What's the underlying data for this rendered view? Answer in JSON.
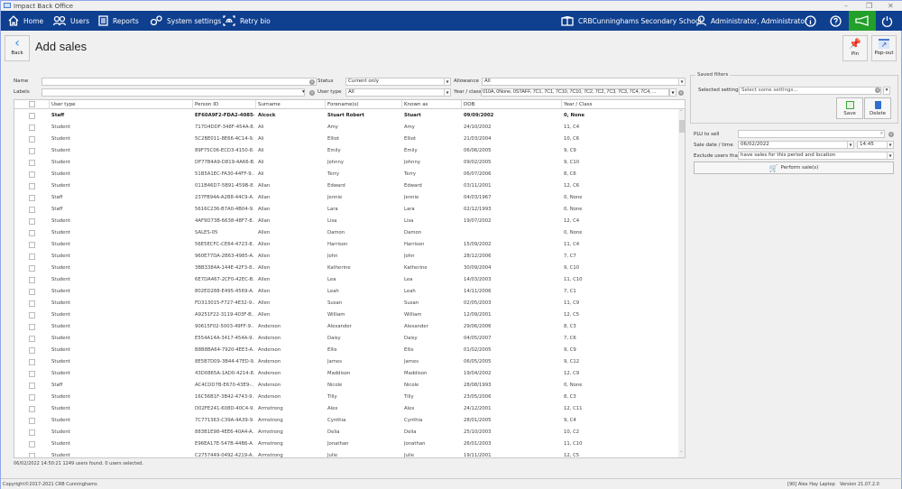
{
  "window": {
    "title": "Impact Back Office"
  },
  "nav": {
    "items": [
      {
        "label": "Home",
        "icon": "home-icon"
      },
      {
        "label": "Users",
        "icon": "users-icon"
      },
      {
        "label": "Reports",
        "icon": "reports-icon"
      },
      {
        "label": "System settings",
        "icon": "gears-icon"
      },
      {
        "label": "Retry bio",
        "icon": "fingerprint-icon"
      }
    ],
    "school": "CRBCunninghams Secondary School",
    "user": "Administrator, Administrator",
    "accent": "#0f3f8f",
    "announce_color": "#22a02a"
  },
  "page": {
    "back_label": "Back",
    "title": "Add sales",
    "pin_label": "Pin",
    "popout_label": "Pop-out"
  },
  "filters": {
    "name_label": "Name",
    "name_value": "",
    "labels_label": "Labels",
    "labels_value": "",
    "status_label": "Status",
    "status_value": "Current only",
    "usertype_label": "User type",
    "usertype_value": "All",
    "allowance_label": "Allowance",
    "allowance_value": "All",
    "yearclass_label": "Year / class",
    "yearclass_value": "010A, 0None, 0STAFF, 7C1, 7C1, 7C10, 7C10, 7C2, 7C2, 7C3, 7C3, 7C4, 7C4, ..."
  },
  "table": {
    "columns": [
      "User type",
      "Person ID",
      "Surname",
      "Forename(s)",
      "Known as",
      "DOB",
      "Year / Class"
    ],
    "rows": [
      [
        "Staff",
        "EF60A9F2-FDA2-4085-8...",
        "Alcock",
        "Stuart Robert",
        "Stuart",
        "09/09/2002",
        "0, None"
      ],
      [
        "Student",
        "717D4DDF-348F-454A-8...",
        "Ali",
        "Amy",
        "Amy",
        "24/10/2002",
        "11, C4"
      ],
      [
        "Student",
        "5C2BE011-8E66-4C14-9...",
        "Ali",
        "Elliot",
        "Elliot",
        "21/03/2004",
        "10, C6"
      ],
      [
        "Student",
        "89F75C06-ECD3-4150-8...",
        "Ali",
        "Emily",
        "Emily",
        "06/06/2005",
        "9, C9"
      ],
      [
        "Student",
        "DF77B4A9-D819-4A66-B...",
        "Ali",
        "Johnny",
        "Johnny",
        "09/02/2005",
        "9, C10"
      ],
      [
        "Student",
        "51B5A1EC-FA30-44FF-9...",
        "Ali",
        "Terry",
        "Terry",
        "06/07/2006",
        "8, C6"
      ],
      [
        "Student",
        "011B46D7-5B91-459B-8...",
        "Allan",
        "Edward",
        "Edward",
        "03/11/2001",
        "12, C6"
      ],
      [
        "Staff",
        "237FB94A-A2B8-44C9-A...",
        "Allan",
        "Jennie",
        "Jennie",
        "04/03/1967",
        "0, None"
      ],
      [
        "Staff",
        "5616C236-B7A0-4B04-9...",
        "Allan",
        "Lara",
        "Lara",
        "02/12/1993",
        "0, None"
      ],
      [
        "Student",
        "4AF9D73B-6638-48F7-8...",
        "Allan",
        "Lisa",
        "Lisa",
        "19/07/2002",
        "12, C4"
      ],
      [
        "Student",
        "SALES-05",
        "Allen",
        "Damon",
        "Damon",
        "",
        "0, None"
      ],
      [
        "Student",
        "56E5ECFC-CE64-4723-8...",
        "Allen",
        "Harrison",
        "Harrison",
        "15/09/2002",
        "11, C4"
      ],
      [
        "Student",
        "960E77DA-2B63-4985-A...",
        "Allen",
        "John",
        "John",
        "28/12/2006",
        "7, C7"
      ],
      [
        "Student",
        "3BB3384A-144E-42F3-8...",
        "Allen",
        "Katherine",
        "Katherine",
        "30/09/2004",
        "9, C10"
      ],
      [
        "Student",
        "6E7DA467-2CF0-42EC-B...",
        "Allen",
        "Lea",
        "Lea",
        "14/03/2003",
        "11, C10"
      ],
      [
        "Student",
        "802ED288-E495-4569-A...",
        "Allen",
        "Leah",
        "Leah",
        "14/11/2006",
        "7, C1"
      ],
      [
        "Student",
        "FD313015-F727-4E32-9...",
        "Allen",
        "Susan",
        "Susan",
        "02/05/2003",
        "11, C9"
      ],
      [
        "Student",
        "A9251F22-3119-403F-B...",
        "Allen",
        "William",
        "William",
        "12/09/2001",
        "12, C5"
      ],
      [
        "Student",
        "90615F02-5003-49FF-9...",
        "Anderson",
        "Alexander",
        "Alexander",
        "29/06/2006",
        "8, C3"
      ],
      [
        "Student",
        "E554A14A-3417-454A-9...",
        "Anderson",
        "Daisy",
        "Daisy",
        "04/05/2007",
        "7, C6"
      ],
      [
        "Student",
        "B8B8BA64-7920-4EE3-A...",
        "Anderson",
        "Ellis",
        "Ellis",
        "01/02/2005",
        "9, C9"
      ],
      [
        "Student",
        "8E5B7D09-3B44-47ED-9...",
        "Anderson",
        "James",
        "James",
        "06/05/2005",
        "9, C12"
      ],
      [
        "Student",
        "43D0865A-1AD0-4214-8...",
        "Anderson",
        "Maddison",
        "Maddison",
        "19/04/2002",
        "12, C9"
      ],
      [
        "Staff",
        "AC4CDD7B-E670-43E9-...",
        "Anderson",
        "Nicole",
        "Nicole",
        "28/08/1993",
        "0, None"
      ],
      [
        "Student",
        "16C56B1F-3B42-4743-9...",
        "Anderson",
        "Tilly",
        "Tilly",
        "23/05/2006",
        "8, C3"
      ],
      [
        "Student",
        "D02FE241-608D-40C4-9...",
        "Armstrong",
        "Alex",
        "Alex",
        "24/12/2001",
        "12, C11"
      ],
      [
        "Student",
        "7C771363-C39A-4A39-9...",
        "Armstrong",
        "Cynthia",
        "Cynthia",
        "28/01/2005",
        "9, C4"
      ],
      [
        "Student",
        "883B1E98-4EE6-40A4-A...",
        "Armstrong",
        "Delia",
        "Delia",
        "25/10/2003",
        "10, C2"
      ],
      [
        "Student",
        "E96EA17E-547B-44B6-A...",
        "Armstrong",
        "Jonathan",
        "Jonathan",
        "26/01/2003",
        "11, C10"
      ],
      [
        "Student",
        "C2757449-0492-4219-A...",
        "Armstrong",
        "Julie",
        "Julie",
        "19/11/2001",
        "12, C5"
      ]
    ]
  },
  "status": "06/02/2022 14:50:21 1249 users found. 0 users selected.",
  "saved_filters": {
    "legend": "Saved filters",
    "selected_label": "Selected settings",
    "selected_placeholder": "Select some settings...",
    "save_label": "Save",
    "delete_label": "Delete"
  },
  "sale": {
    "plu_label": "PLU to sell",
    "plu_value": "",
    "date_label": "Sale date / time",
    "date_value": "06/02/2022",
    "time_value": "14:45",
    "exclude_label": "Exclude users that",
    "exclude_value": "have sales for this period and location",
    "perform_label": "Perform sale(s)"
  },
  "footer": {
    "copyright": "Copyright©2017-2021 CRB Cunninghams",
    "device": "[90] Alex Hay Laptop",
    "version": "Version 21.07.2.0"
  }
}
